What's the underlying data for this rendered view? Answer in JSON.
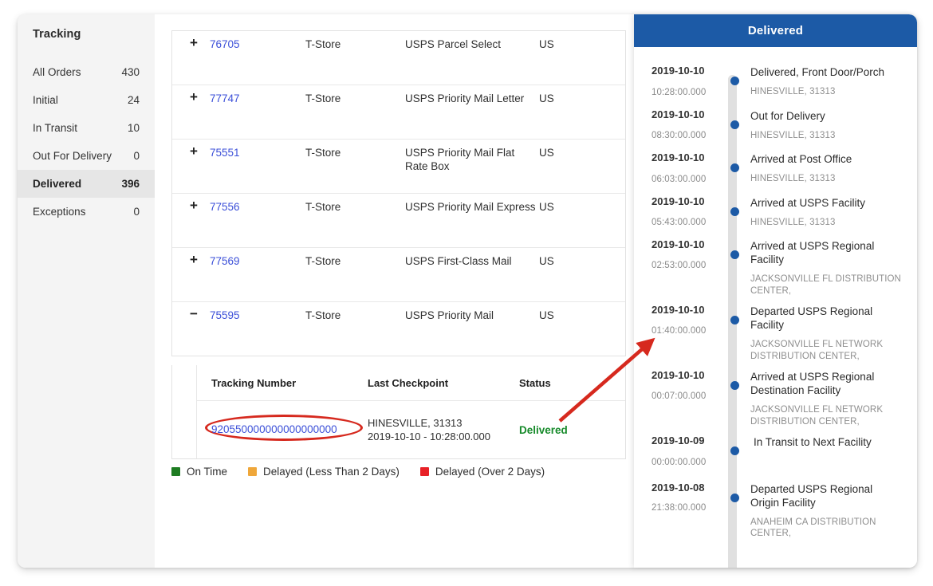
{
  "sidebar": {
    "title": "Tracking",
    "items": [
      {
        "label": "All Orders",
        "count": "430",
        "active": false
      },
      {
        "label": "Initial",
        "count": "24",
        "active": false
      },
      {
        "label": "In Transit",
        "count": "10",
        "active": false
      },
      {
        "label": "Out For Delivery",
        "count": "0",
        "active": false
      },
      {
        "label": "Delivered",
        "count": "396",
        "active": true
      },
      {
        "label": "Exceptions",
        "count": "0",
        "active": false
      }
    ]
  },
  "orders_table": {
    "rows": [
      {
        "toggle": "+",
        "order_id": "76705",
        "store": "T-Store",
        "service": "USPS Parcel Select",
        "country": "US"
      },
      {
        "toggle": "+",
        "order_id": "77747",
        "store": "T-Store",
        "service": "USPS Priority Mail Letter",
        "country": "US"
      },
      {
        "toggle": "+",
        "order_id": "75551",
        "store": "T-Store",
        "service": "USPS Priority Mail Flat Rate Box",
        "country": "US"
      },
      {
        "toggle": "+",
        "order_id": "77556",
        "store": "T-Store",
        "service": "USPS Priority Mail Express",
        "country": "US"
      },
      {
        "toggle": "+",
        "order_id": "77569",
        "store": "T-Store",
        "service": "USPS First-Class Mail",
        "country": "US"
      },
      {
        "toggle": "−",
        "order_id": "75595",
        "store": "T-Store",
        "service": "USPS Priority Mail",
        "country": "US"
      }
    ]
  },
  "detail_table": {
    "headers": {
      "tracking_number": "Tracking Number",
      "last_checkpoint": "Last Checkpoint",
      "status": "Status"
    },
    "row": {
      "tracking_number": "920550000000000000000",
      "checkpoint_location": "HINESVILLE,  31313",
      "checkpoint_datetime": "2019-10-10 - 10:28:00.000",
      "status": "Delivered",
      "status_color": "#168a2a",
      "highlight_color": "#d6291e"
    }
  },
  "legend": {
    "items": [
      {
        "label": "On Time",
        "color": "#1e7c22"
      },
      {
        "label": "Delayed (Less Than 2 Days)",
        "color": "#efa73a"
      },
      {
        "label": "Delayed (Over 2 Days)",
        "color": "#e82127"
      }
    ]
  },
  "timeline": {
    "header": "Delivered",
    "header_color": "#1c5aa6",
    "dot_color": "#1c5aa6",
    "events": [
      {
        "date": "2019-10-10",
        "time": "10:28:00.000",
        "title": "Delivered, Front Door/Porch",
        "location": "HINESVILLE, 31313"
      },
      {
        "date": "2019-10-10",
        "time": "08:30:00.000",
        "title": "Out for Delivery",
        "location": "HINESVILLE, 31313"
      },
      {
        "date": "2019-10-10",
        "time": "06:03:00.000",
        "title": "Arrived at Post Office",
        "location": "HINESVILLE, 31313"
      },
      {
        "date": "2019-10-10",
        "time": "05:43:00.000",
        "title": "Arrived at USPS Facility",
        "location": "HINESVILLE, 31313"
      },
      {
        "date": "2019-10-10",
        "time": "02:53:00.000",
        "title": "Arrived at USPS Regional Facility",
        "location": "JACKSONVILLE FL DISTRIBUTION CENTER,"
      },
      {
        "date": "2019-10-10",
        "time": "01:40:00.000",
        "title": "Departed USPS Regional Facility",
        "location": "JACKSONVILLE FL NETWORK DISTRIBUTION CENTER,"
      },
      {
        "date": "2019-10-10",
        "time": "00:07:00.000",
        "title": "Arrived at USPS Regional Destination Facility",
        "location": "JACKSONVILLE FL NETWORK DISTRIBUTION CENTER,"
      },
      {
        "date": "2019-10-09",
        "time": "00:00:00.000",
        "title": "In Transit to Next Facility",
        "location": ""
      },
      {
        "date": "2019-10-08",
        "time": "21:38:00.000",
        "title": "Departed USPS Regional Origin Facility",
        "location": "ANAHEIM CA DISTRIBUTION CENTER,"
      }
    ]
  },
  "annotation": {
    "arrow_color": "#d6291e"
  }
}
